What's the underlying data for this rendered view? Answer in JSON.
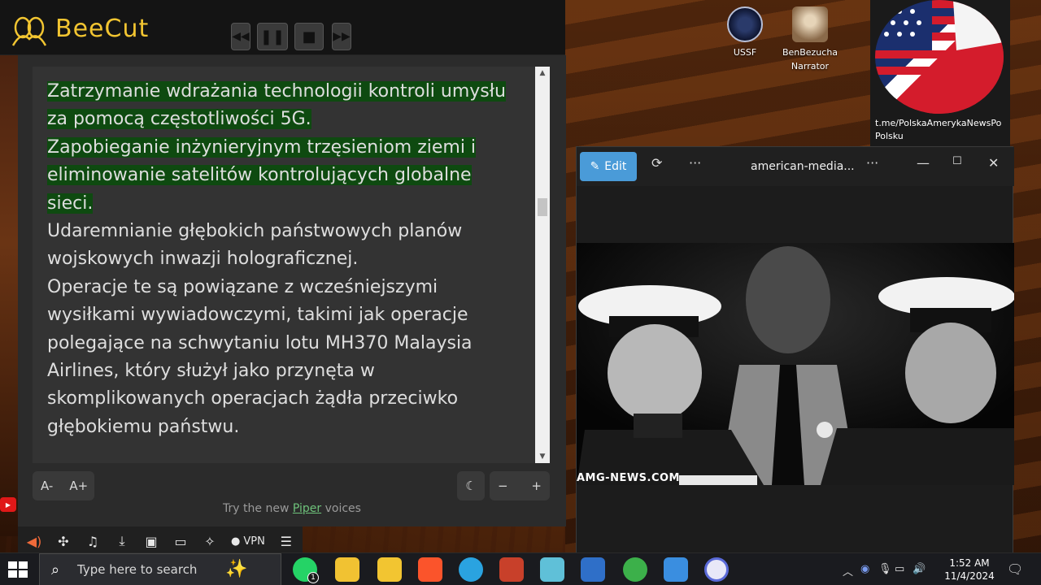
{
  "app": {
    "name": "BeeCut"
  },
  "reader": {
    "highlighted_lines": [
      "Zatrzymanie wdrażania technologii kontroli umysłu",
      "za pomocą częstotliwości 5G.",
      "Zapobieganie inżynieryjnym trzęsieniom ziemi i",
      "eliminowanie satelitów kontrolujących globalne",
      "sieci."
    ],
    "plain_lines": [
      "Udaremnianie głębokich państwowych planów",
      "wojskowych inwazji holograficznej.",
      "Operacje te są powiązane z wcześniejszymi",
      "wysiłkami wywiadowczymi, takimi jak operacje",
      "polegające na schwytaniu lotu MH370 Malaysia",
      "Airlines, który służył jako przynęta w",
      "skomplikowanych operacjach żądła przeciwko",
      "głębokiemu państwu."
    ],
    "font_decrease": "A-",
    "font_increase": "A+",
    "rate_minus": "−",
    "rate_plus": "+",
    "piper_prefix": "Try the new ",
    "piper_link": "Piper",
    "piper_suffix": " voices"
  },
  "bottom_toolbar": {
    "vpn_label": "VPN"
  },
  "desktop_icons": [
    {
      "label": "USSF"
    },
    {
      "label_line1": "BenBezucha",
      "label_line2": "Narrator"
    }
  ],
  "flag_tile": {
    "url_line1": "t.me/PolskaAmerykaNewsPo",
    "url_line2": "Polsku"
  },
  "photos_window": {
    "edit_label": "Edit",
    "title": "american-media...",
    "watermark": "AMG-NEWS.COM"
  },
  "taskbar": {
    "search_placeholder": "Type here to search",
    "time": "1:52 AM",
    "date": "11/4/2024",
    "whatsapp_badge": "1"
  },
  "colors": {
    "highlight": "#0e4a10",
    "brand_yellow": "#f2c531",
    "edit_blue": "#4a9bd8"
  }
}
